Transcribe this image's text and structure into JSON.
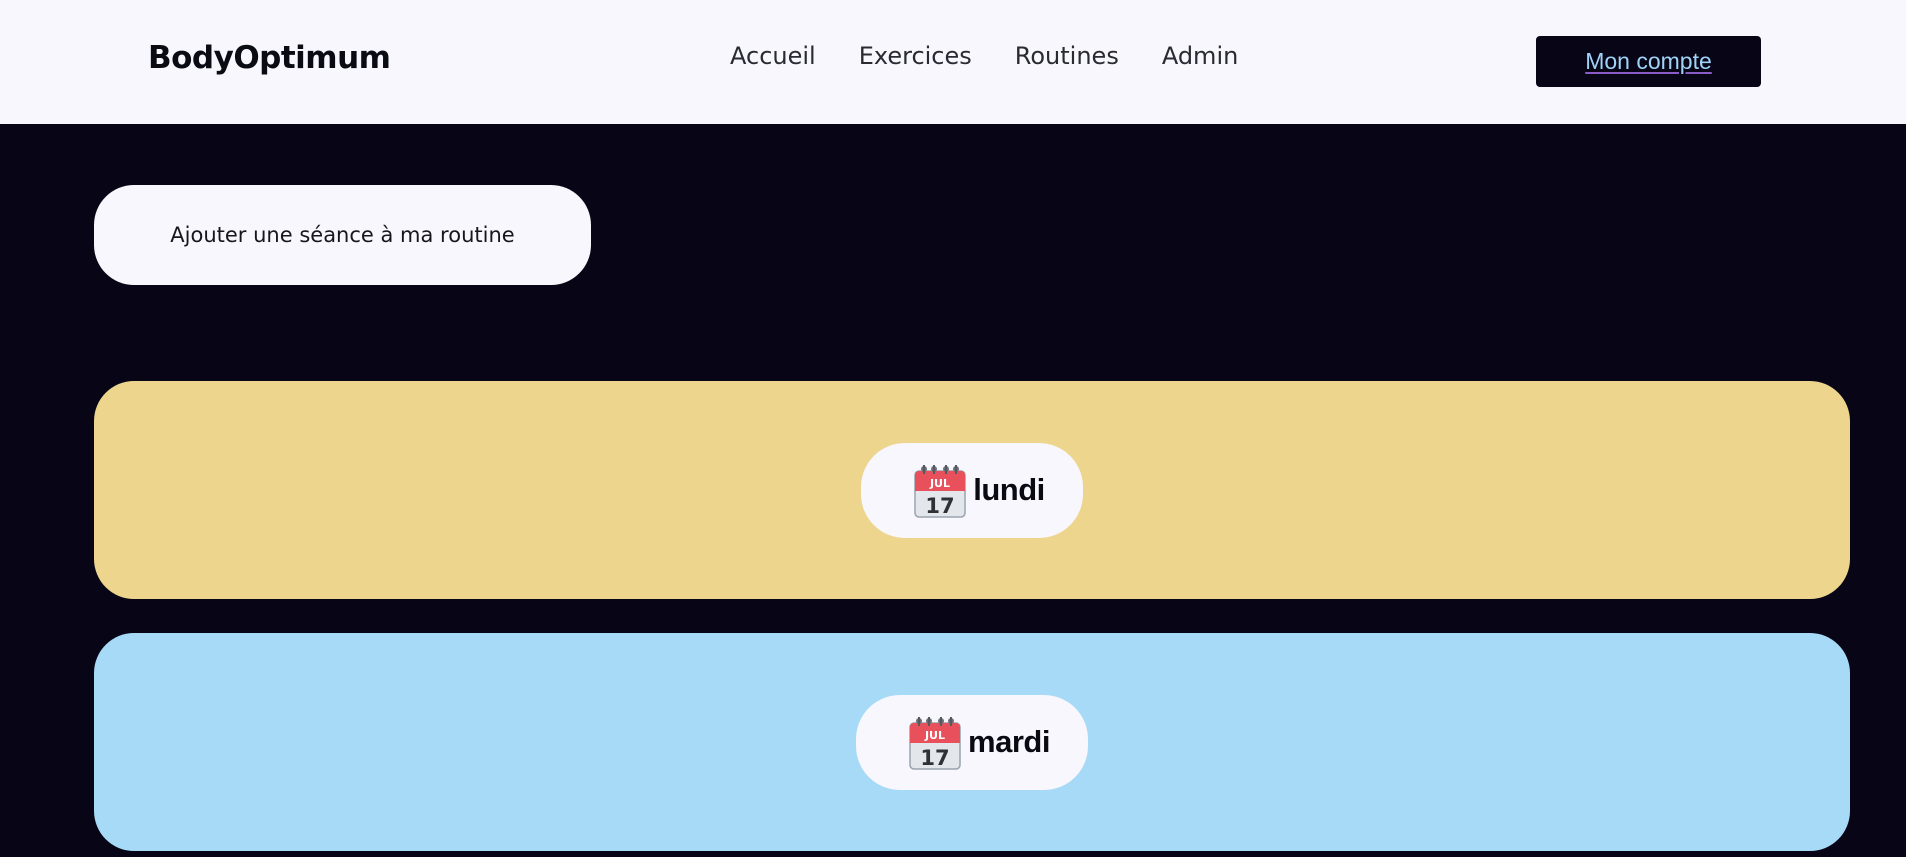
{
  "navbar": {
    "brand": "BodyOptimum",
    "links": [
      {
        "label": "Accueil"
      },
      {
        "label": "Exercices"
      },
      {
        "label": "Routines"
      },
      {
        "label": "Admin"
      }
    ],
    "account_label": "Mon compte"
  },
  "main": {
    "add_session_label": "Ajouter une séance à ma routine",
    "days": [
      {
        "label": "lundi",
        "icon": "calendar-icon",
        "color": "#edd58d",
        "calendar_month": "JUL",
        "calendar_day": "17"
      },
      {
        "label": "mardi",
        "icon": "calendar-icon",
        "color": "#a6daf7",
        "calendar_month": "JUL",
        "calendar_day": "17"
      }
    ]
  },
  "colors": {
    "background": "#080616",
    "navbar": "#f7f7fd",
    "account_text": "#9fd3f7",
    "account_underline": "#8a5cc7"
  }
}
